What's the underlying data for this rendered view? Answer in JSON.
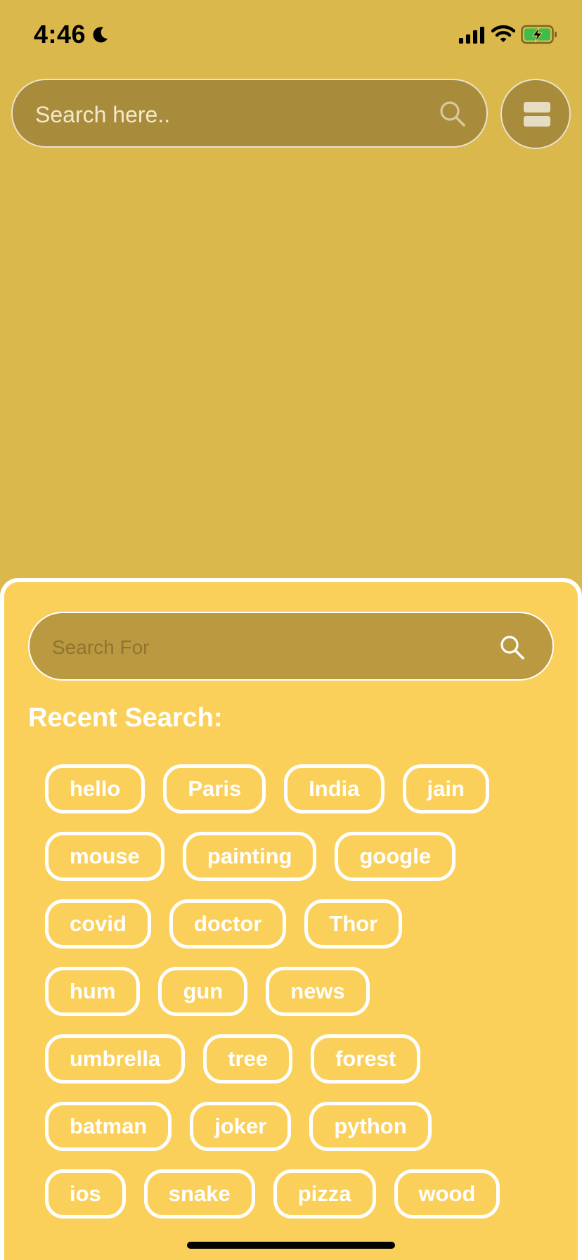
{
  "status_bar": {
    "time": "4:46"
  },
  "top_search": {
    "placeholder": "Search here.."
  },
  "sheet": {
    "search_placeholder": "Search For",
    "recent_title": "Recent Search:",
    "recent_rows": [
      [
        "hello",
        "Paris",
        "India",
        "jain"
      ],
      [
        "mouse",
        "painting",
        "google"
      ],
      [
        "covid",
        "doctor",
        "Thor"
      ],
      [
        "hum",
        "gun",
        "news"
      ],
      [
        "umbrella",
        "tree",
        "forest"
      ],
      [
        "batman",
        "joker",
        "python"
      ],
      [
        "ios",
        "snake",
        "pizza",
        "wood"
      ]
    ]
  },
  "colors": {
    "background": "#DBB84B",
    "sheet": "#FAD05A",
    "search_field": "#A88B3B"
  },
  "icons": {
    "moon": "moon-icon",
    "signal": "signal-icon",
    "wifi": "wifi-icon",
    "battery": "battery-charging-icon",
    "search": "search-icon",
    "layout": "layout-toggle-icon"
  }
}
